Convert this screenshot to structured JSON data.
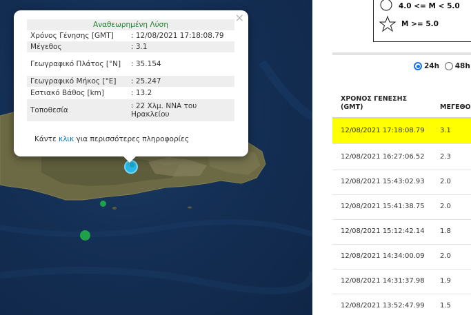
{
  "popup": {
    "title": "Αναθεωρημένη Λύση",
    "close_icon": "×",
    "rows": [
      {
        "label": "Χρόνος Γένησης [GMT]",
        "value": ": 12/08/2021 17:18:08.79"
      },
      {
        "label": "Μέγεθος",
        "value": ": 3.1"
      },
      {
        "label": "Γεωγραφικό Πλάτος [°N]",
        "value": ": 35.154"
      },
      {
        "label": "Γεωγραφικό Μήκος [°E]",
        "value": ": 25.247"
      },
      {
        "label": "Εστιακό Βάθος [km]",
        "value": ": 13.2"
      },
      {
        "label": "Τοποθεσία",
        "value": ": 22 Χλμ. ΝΝΑ του Ηρακλείου"
      }
    ],
    "more_prefix": "Κάντε ",
    "more_link": "κλικ",
    "more_suffix": " για περισσότερες πληροφορίες"
  },
  "legend": {
    "items": [
      {
        "icon": "circle-icon",
        "label": "4.0 <= M < 5.0"
      },
      {
        "icon": "star-icon",
        "label": "M >= 5.0"
      }
    ]
  },
  "filters": {
    "options": [
      {
        "label": "24h",
        "selected": true
      },
      {
        "label": "48h",
        "selected": false
      },
      {
        "label": "48",
        "selected": false
      }
    ]
  },
  "table": {
    "headers": [
      "ΧΡΟΝΟΣ ΓΕΝΕΣΗΣ (GMT)",
      "ΜΕΓΕΘΟΣ"
    ],
    "header_line1": "ΧΡΟΝΟΣ ΓΕΝΕΣΗΣ",
    "header_line2": "(GMT)",
    "header_mag": "ΜΕΓΕΘΟΣ",
    "rows": [
      {
        "time": "12/08/2021 17:18:08.79",
        "mag": "3.1",
        "highlight": true
      },
      {
        "time": "12/08/2021 16:27:06.52",
        "mag": "2.3",
        "highlight": false
      },
      {
        "time": "12/08/2021 15:43:02.93",
        "mag": "2.0",
        "highlight": false
      },
      {
        "time": "12/08/2021 15:41:38.75",
        "mag": "2.0",
        "highlight": false
      },
      {
        "time": "12/08/2021 15:12:42.14",
        "mag": "1.8",
        "highlight": false
      },
      {
        "time": "12/08/2021 14:34:00.09",
        "mag": "2.0",
        "highlight": false
      },
      {
        "time": "12/08/2021 14:31:37.98",
        "mag": "1.9",
        "highlight": false
      },
      {
        "time": "12/08/2021 13:52:47.99",
        "mag": "1.5",
        "highlight": false
      }
    ]
  },
  "colors": {
    "highlight": "#ffff00",
    "accent": "#1a73e8",
    "popup_title": "#1e7d2c",
    "marker_selected": "#29b6e6",
    "marker_green": "#1fa14a"
  }
}
